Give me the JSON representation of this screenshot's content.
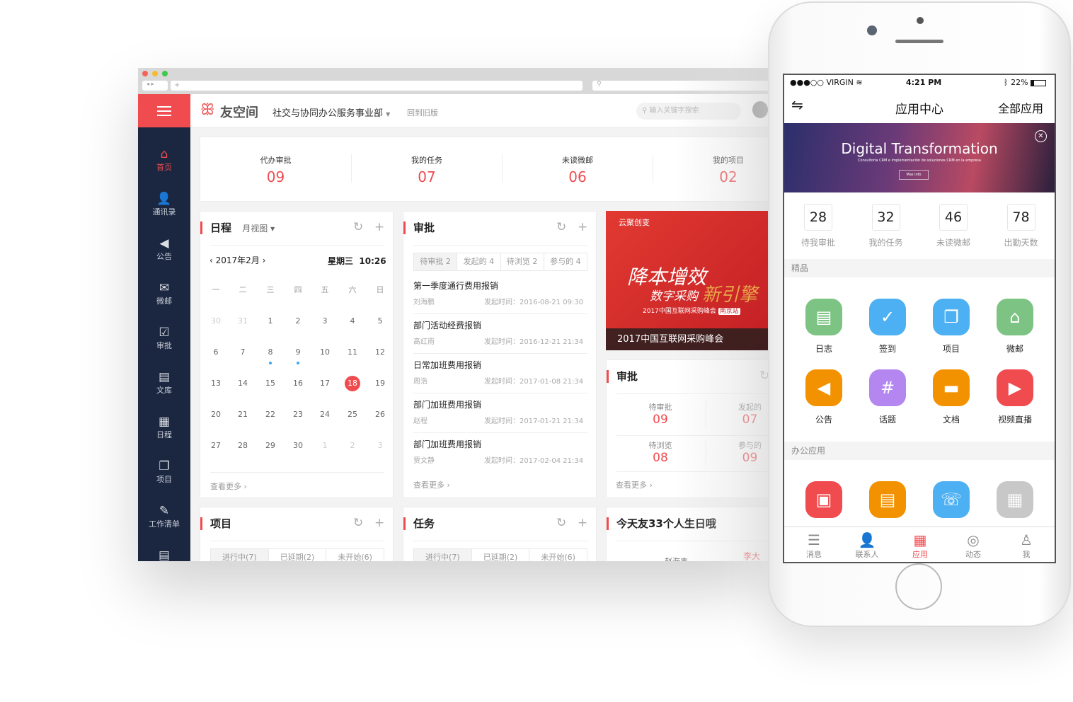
{
  "browser": {
    "url": "+",
    "colors": {
      "close": "#f2625b",
      "min": "#f5bc2f",
      "max": "#3ec94a"
    }
  },
  "header": {
    "logo": "友空间",
    "org": "社交与协同办公服务事业部",
    "back_old": "回到旧版",
    "search_placeholder": "输入关键字搜索",
    "accent": "#f04b4f"
  },
  "sidebar": {
    "items": [
      {
        "label": "首页",
        "icon": "home-icon",
        "glyph": "⌂"
      },
      {
        "label": "通讯录",
        "icon": "contacts-icon",
        "glyph": "👤"
      },
      {
        "label": "公告",
        "icon": "megaphone-icon",
        "glyph": "◀"
      },
      {
        "label": "微邮",
        "icon": "mail-icon",
        "glyph": "✉"
      },
      {
        "label": "审批",
        "icon": "checkbox-icon",
        "glyph": "☑"
      },
      {
        "label": "文库",
        "icon": "document-icon",
        "glyph": "▤"
      },
      {
        "label": "日程",
        "icon": "calendar-icon",
        "glyph": "▦"
      },
      {
        "label": "项目",
        "icon": "project-icon",
        "glyph": "❐"
      },
      {
        "label": "工作清单",
        "icon": "edit-icon",
        "glyph": "✎"
      },
      {
        "label": "",
        "icon": "note-icon",
        "glyph": "▤"
      }
    ]
  },
  "stats": [
    {
      "label": "代办审批",
      "value": "09"
    },
    {
      "label": "我的任务",
      "value": "07"
    },
    {
      "label": "未读微邮",
      "value": "06"
    },
    {
      "label": "我的项目",
      "value": "02"
    }
  ],
  "calendar": {
    "title": "日程",
    "view": "月视图",
    "month": "2017年2月",
    "weekday": "星期三",
    "time": "10:26",
    "weekdays": [
      "一",
      "二",
      "三",
      "四",
      "五",
      "六",
      "日"
    ],
    "days": [
      [
        "30",
        "31",
        "1",
        "2",
        "3",
        "4",
        "5"
      ],
      [
        "6",
        "7",
        "8",
        "9",
        "10",
        "11",
        "12"
      ],
      [
        "13",
        "14",
        "15",
        "16",
        "17",
        "18",
        "19"
      ],
      [
        "20",
        "21",
        "22",
        "23",
        "24",
        "25",
        "26"
      ],
      [
        "27",
        "28",
        "29",
        "30",
        "1",
        "2",
        "3"
      ]
    ],
    "muted": [
      [
        0,
        0
      ],
      [
        0,
        1
      ],
      [
        4,
        4
      ],
      [
        4,
        5
      ],
      [
        4,
        6
      ]
    ],
    "event_dots": [
      [
        1,
        2
      ],
      [
        1,
        3
      ]
    ],
    "today": [
      2,
      5
    ],
    "more": "查看更多"
  },
  "approval": {
    "title": "审批",
    "tabs": [
      "待审批 2",
      "发起的 4",
      "待浏览 2",
      "参与的 4"
    ],
    "items": [
      {
        "title": "第一季度通行费用报销",
        "person": "刘海鹏",
        "time": "发起时间：2016-08-21 09:30"
      },
      {
        "title": "部门活动经费报销",
        "person": "高红雨",
        "time": "发起时间：2016-12-21 21:34"
      },
      {
        "title": "日常加班费用报销",
        "person": "周浩",
        "time": "发起时间：2017-01-08 21:34"
      },
      {
        "title": "部门加班费用报销",
        "person": "赵程",
        "time": "发起时间：2017-01-21 21:34"
      },
      {
        "title": "部门加班费用报销",
        "person": "贾文静",
        "time": "发起时间：2017-02-04 21:34"
      }
    ],
    "more": "查看更多"
  },
  "banner": {
    "badge": "云聚创变",
    "headline1": "降本增效",
    "headline2": "数字采购",
    "headline3": "新引擎",
    "sub": "2017中国互联网采购峰会",
    "station": "南京站",
    "caption": "2017中国互联网采购峰会"
  },
  "approval2": {
    "title": "审批",
    "cells": [
      {
        "label": "待审批",
        "value": "09"
      },
      {
        "label": "发起的",
        "value": "07"
      },
      {
        "label": "待浏览",
        "value": "08"
      },
      {
        "label": "参与的",
        "value": "09"
      }
    ],
    "more": "查看更多"
  },
  "project": {
    "title": "项目",
    "tabs": [
      "进行中(7)",
      "已延期(2)",
      "未开始(6)"
    ]
  },
  "task": {
    "title": "任务",
    "tabs": [
      "进行中(7)",
      "已延期(2)",
      "未开始(6)"
    ]
  },
  "birthday": {
    "title": "今天友33个人生日哦",
    "names": [
      "赵海丰",
      "李大"
    ]
  },
  "phone": {
    "status": {
      "carrier": "●●●○○ VIRGIN",
      "time": "4:21 PM",
      "battery": "22%",
      "battery_level": 0.22
    },
    "nav": {
      "title": "应用中心",
      "right": "全部应用"
    },
    "ad": {
      "title": "Digital Transformation",
      "sub": "Consultoría CRM e Implementación de soluciones CRM en la empresa",
      "button": "Mas info"
    },
    "stats": [
      {
        "value": "28",
        "label": "待我审批"
      },
      {
        "value": "32",
        "label": "我的任务"
      },
      {
        "value": "46",
        "label": "未读微邮"
      },
      {
        "value": "78",
        "label": "出勤天数"
      }
    ],
    "section1": "精品",
    "apps1": [
      {
        "label": "日志",
        "color": "#7dc384",
        "glyph": "▤",
        "icon": "log-icon"
      },
      {
        "label": "签到",
        "color": "#4db0f2",
        "glyph": "✓",
        "icon": "checkin-icon"
      },
      {
        "label": "项目",
        "color": "#4db0f2",
        "glyph": "❐",
        "icon": "project-icon"
      },
      {
        "label": "微邮",
        "color": "#7dc384",
        "glyph": "⌂",
        "icon": "inbox-icon"
      },
      {
        "label": "公告",
        "color": "#f39200",
        "glyph": "◀",
        "icon": "megaphone-icon"
      },
      {
        "label": "话题",
        "color": "#b486f0",
        "glyph": "#",
        "icon": "hashtag-icon"
      },
      {
        "label": "文档",
        "color": "#f39200",
        "glyph": "▬",
        "icon": "folder-icon"
      },
      {
        "label": "视频直播",
        "color": "#f04b4f",
        "glyph": "▶",
        "icon": "video-icon"
      }
    ],
    "section2": "办公应用",
    "apps2": [
      {
        "color": "#f04b4f",
        "glyph": "▣",
        "icon": "news-icon"
      },
      {
        "color": "#f39200",
        "glyph": "▤",
        "icon": "file-icon"
      },
      {
        "color": "#4db0f2",
        "glyph": "☏",
        "icon": "phone-call-icon"
      },
      {
        "color": "#c8c8c8",
        "glyph": "▦",
        "icon": "more-apps-icon"
      }
    ],
    "tabs": [
      {
        "label": "消息",
        "glyph": "☰",
        "icon": "message-icon"
      },
      {
        "label": "联系人",
        "glyph": "👤",
        "icon": "contacts-icon"
      },
      {
        "label": "应用",
        "glyph": "▦",
        "icon": "apps-icon",
        "active": true
      },
      {
        "label": "动态",
        "glyph": "◎",
        "icon": "activity-icon"
      },
      {
        "label": "我",
        "glyph": "♙",
        "icon": "profile-icon"
      }
    ]
  }
}
